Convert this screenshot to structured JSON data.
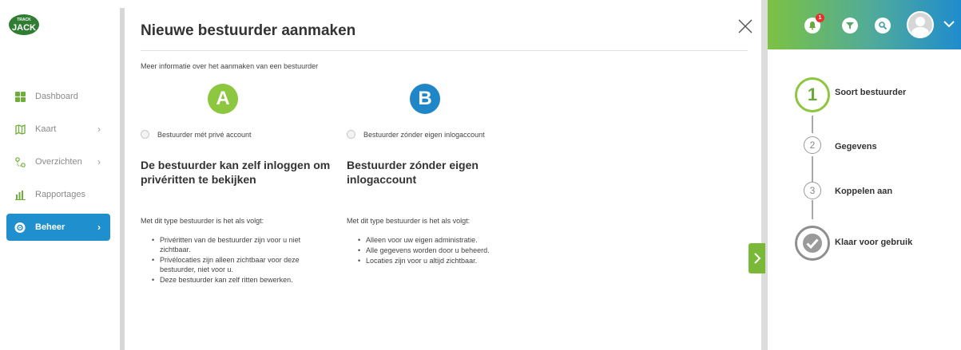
{
  "brand": {
    "logo_text": "JACK",
    "logo_small": "TRACK"
  },
  "sidebar": {
    "items": [
      {
        "label": "Dashboard",
        "icon": "dashboard-icon",
        "has_chevron": false,
        "active": false
      },
      {
        "label": "Kaart",
        "icon": "map-icon",
        "has_chevron": true,
        "active": false
      },
      {
        "label": "Overzichten",
        "icon": "route-icon",
        "has_chevron": true,
        "active": false
      },
      {
        "label": "Rapportages",
        "icon": "bar-chart-icon",
        "has_chevron": false,
        "active": false
      },
      {
        "label": "Beheer",
        "icon": "gear-icon",
        "has_chevron": true,
        "active": true
      }
    ]
  },
  "modal": {
    "title": "Nieuwe bestuurder aanmaken",
    "info_link": "Meer informatie over het aanmaken van een bestuurder",
    "options": [
      {
        "letter": "A",
        "radio_label": "Bestuurder mét privé account",
        "heading": "De bestuurder kan zelf inloggen om privéritten te bekijken",
        "subhead": "Met dit type bestuurder is het als volgt:",
        "bullets": [
          "Privéritten van de bestuurder zijn voor u niet zichtbaar.",
          "Privélocaties zijn alleen zichtbaar voor deze bestuurder, niet voor u.",
          "Deze bestuurder kan zelf ritten bewerken."
        ]
      },
      {
        "letter": "B",
        "radio_label": "Bestuurder zónder eigen inlogaccount",
        "heading": "Bestuurder zónder eigen inlogaccount",
        "subhead": "Met dit type bestuurder is het als volgt:",
        "bullets": [
          "Alleen voor uw eigen administratie.",
          "Alle gegevens worden door u beheerd.",
          "Locaties zijn voor u altijd zichtbaar."
        ]
      }
    ]
  },
  "topbar": {
    "notification_count": "1"
  },
  "steps": [
    {
      "number": "1",
      "label": "Soort bestuurder",
      "state": "active"
    },
    {
      "number": "2",
      "label": "Gegevens",
      "state": "pending"
    },
    {
      "number": "3",
      "label": "Koppelen aan",
      "state": "pending"
    },
    {
      "number": "",
      "label": "Klaar voor gebruik",
      "state": "final"
    }
  ],
  "colors": {
    "accent_green": "#8dc63f",
    "accent_blue": "#1f86c7",
    "active_nav": "#1f8fce",
    "badge_red": "#e4342d"
  }
}
